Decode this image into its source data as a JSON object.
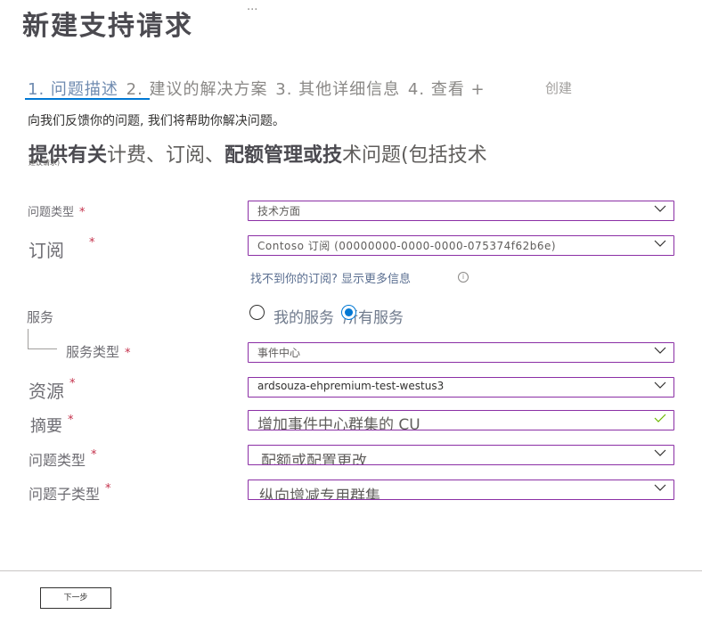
{
  "header": {
    "title": "新建支持请求",
    "more_label": "···"
  },
  "steps": {
    "items": [
      "1. 问题描述",
      "2. 建议的解决方案",
      "3. 其他详细信息",
      "4. 查看 +"
    ],
    "create": "创建"
  },
  "intro": {
    "description": "向我们反馈你的问题, 我们将帮助你解决问题。",
    "heading_bold1": "提供有关",
    "heading_normal1": "计费、订阅、",
    "heading_bold2": "配额管理或技",
    "heading_normal2": "术问题(包括技术",
    "heading_cont": "建议请求)"
  },
  "form": {
    "issue_type": {
      "label": "问题类型",
      "value": "技术方面"
    },
    "subscription": {
      "label": "订阅",
      "value": "Contoso 订阅 (00000000-0000-0000-075374f62b6e)",
      "help_link": "找不到你的订阅? 显示更多信息",
      "info_icon": "info-icon"
    },
    "service": {
      "label": "服务",
      "options": [
        "我的服务",
        "所有服务"
      ],
      "selected": "所有服务"
    },
    "service_type": {
      "label": "服务类型",
      "value": "事件中心"
    },
    "resource": {
      "label": "资源",
      "value": "ardsouza-ehpremium-test-westus3"
    },
    "summary": {
      "label": "摘要",
      "value": "增加事件中心群集的 CU"
    },
    "problem_type": {
      "label": "问题类型",
      "value": "配额或配置更改"
    },
    "problem_subtype": {
      "label": "问题子类型",
      "value": "纵向增减专用群集"
    },
    "required_mark": "*"
  },
  "footer": {
    "next_label": "下一步"
  },
  "colors": {
    "accent": "#0078d4",
    "field_border": "#8b2fa5",
    "required": "#c4314b",
    "valid": "#6bb700"
  }
}
